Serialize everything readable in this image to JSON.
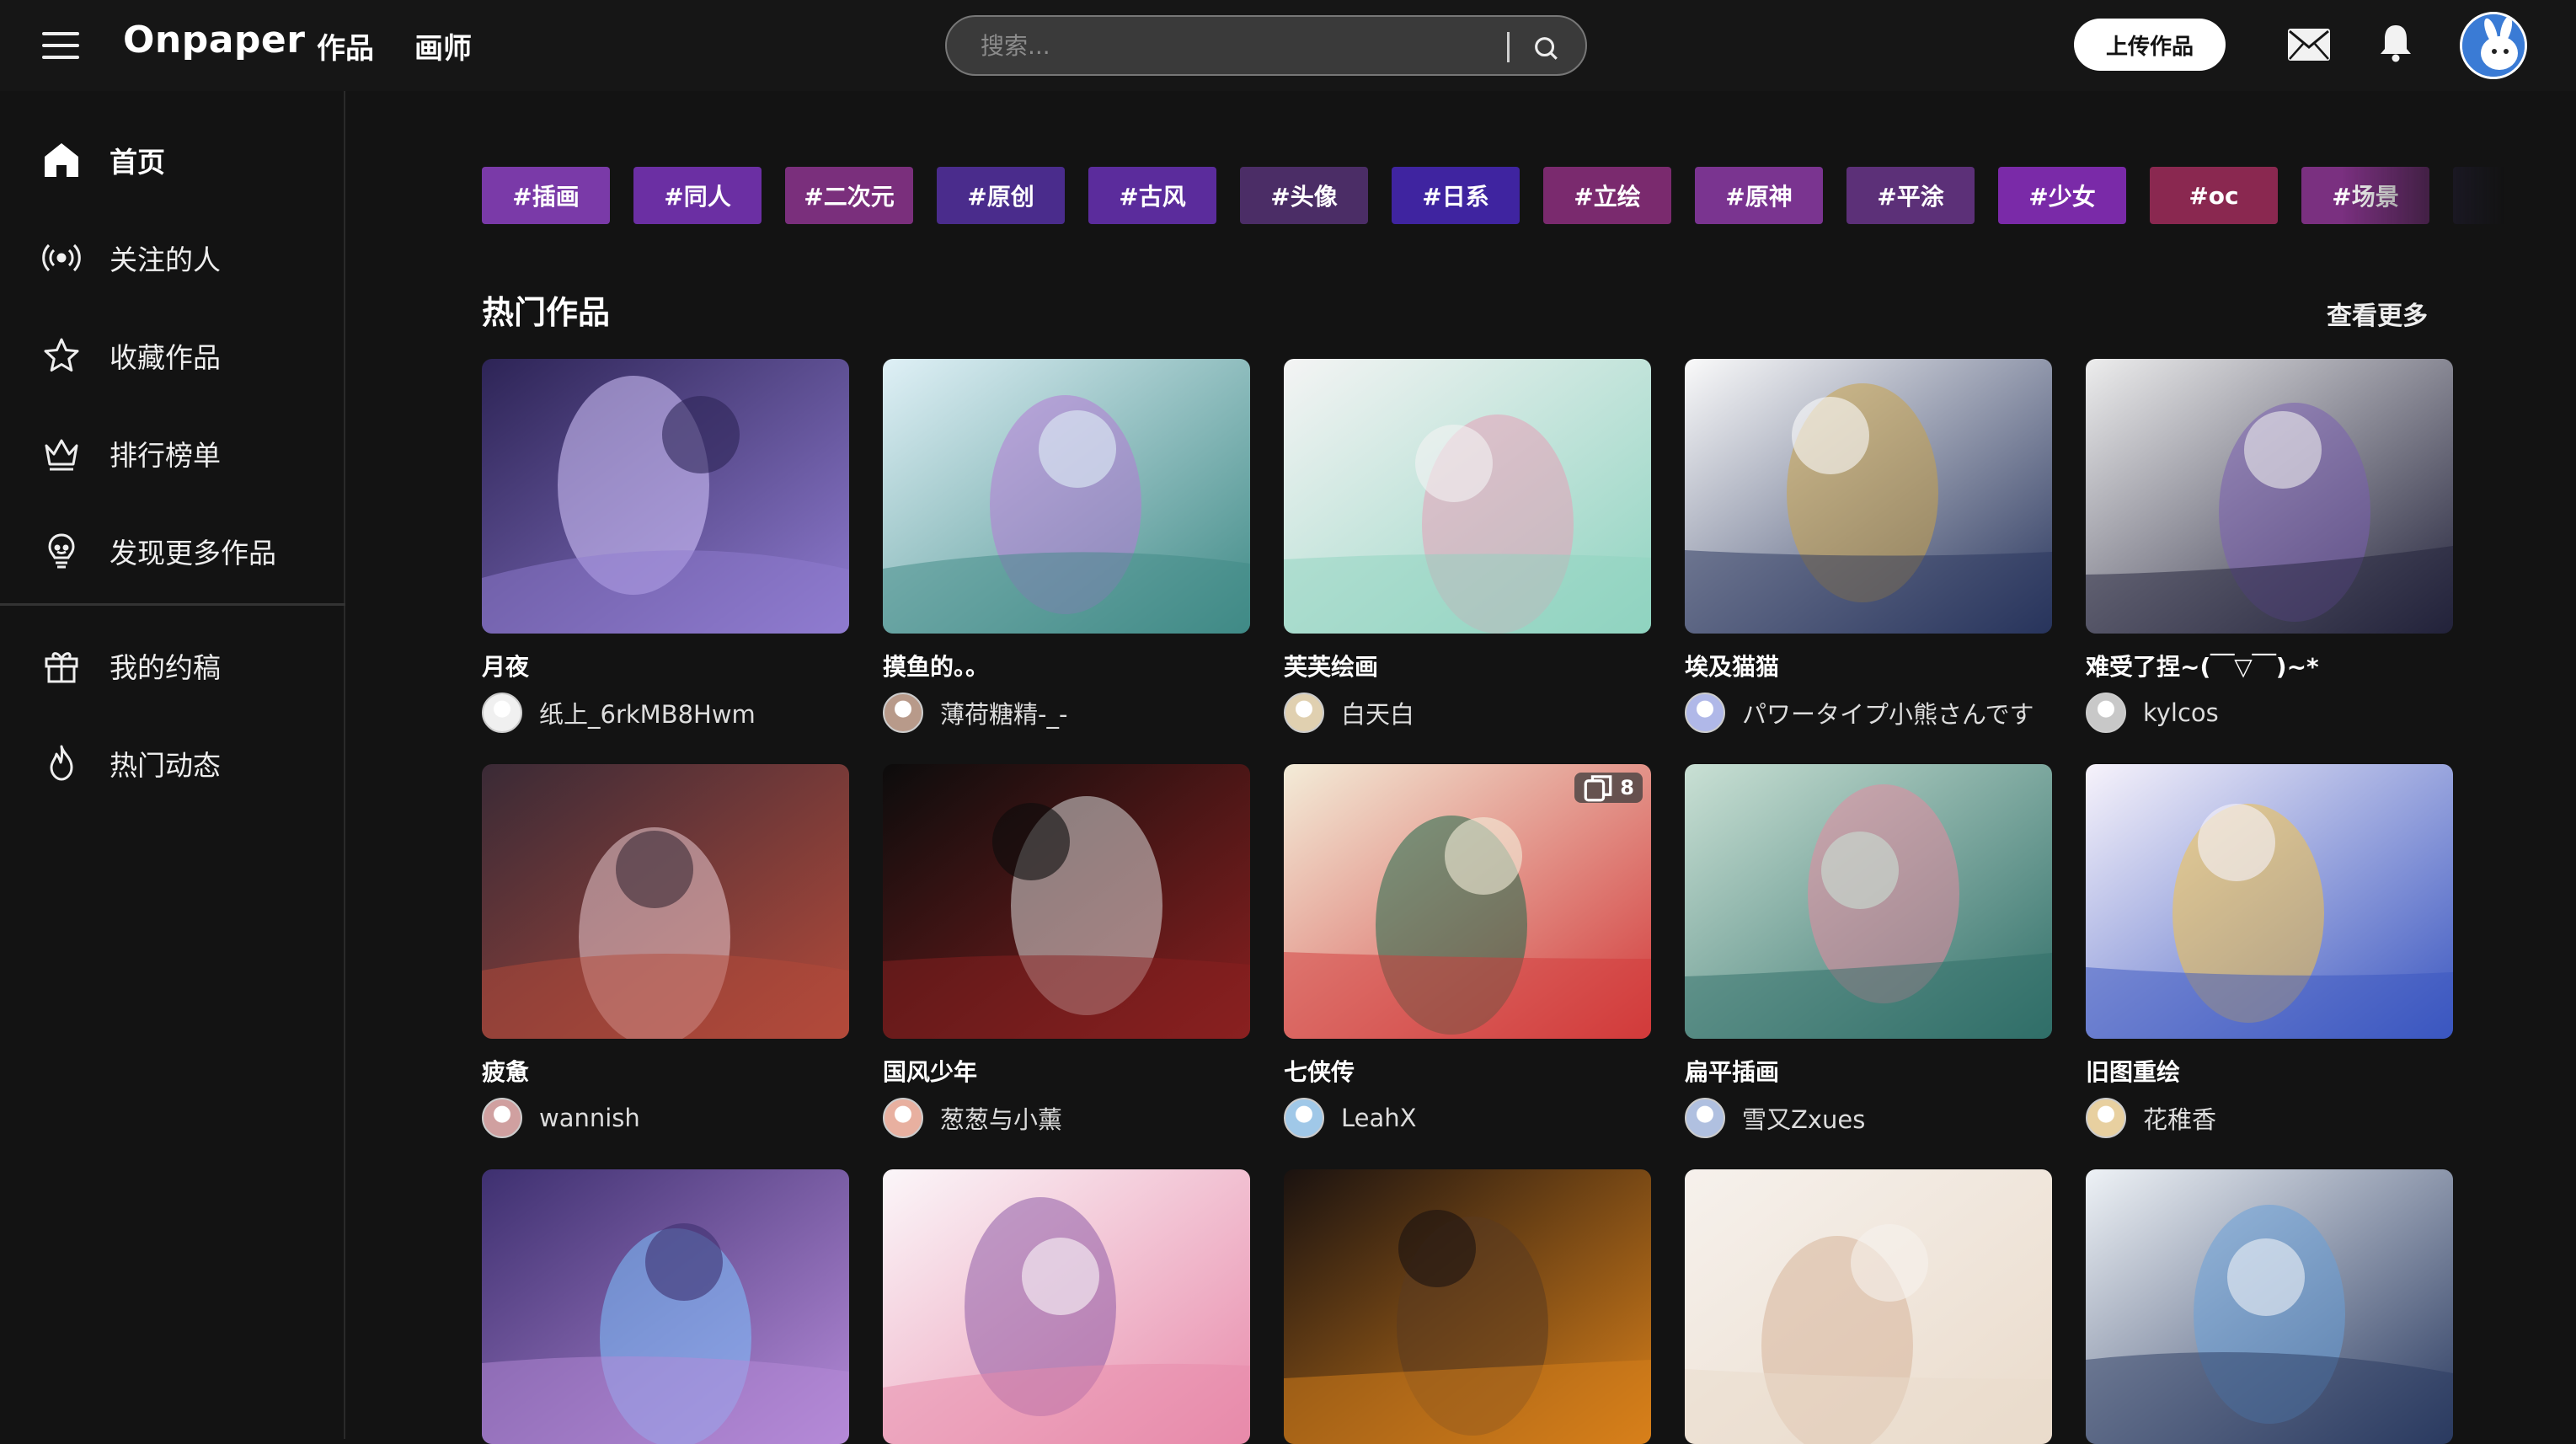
{
  "header": {
    "logo": "Onpaper",
    "nav": [
      "作品",
      "画师"
    ],
    "search_placeholder": "搜索...",
    "upload_label": "上传作品"
  },
  "sidebar": {
    "items": [
      {
        "label": "首页",
        "icon": "home-icon",
        "active": true
      },
      {
        "label": "关注的人",
        "icon": "broadcast-icon"
      },
      {
        "label": "收藏作品",
        "icon": "star-icon"
      },
      {
        "label": "排行榜单",
        "icon": "crown-icon"
      },
      {
        "label": "发现更多作品",
        "icon": "lightbulb-icon"
      },
      {
        "label": "我的约稿",
        "icon": "gift-icon"
      },
      {
        "label": "热门动态",
        "icon": "flame-icon"
      }
    ]
  },
  "tags": [
    {
      "label": "#插画",
      "color": "#7a3aa8"
    },
    {
      "label": "#同人",
      "color": "#6b2fa3"
    },
    {
      "label": "#二次元",
      "color": "#7a2f7c"
    },
    {
      "label": "#原创",
      "color": "#4a2c8c"
    },
    {
      "label": "#古风",
      "color": "#5b2c9c"
    },
    {
      "label": "#头像",
      "color": "#4b2d66"
    },
    {
      "label": "#日系",
      "color": "#3f24a0"
    },
    {
      "label": "#立绘",
      "color": "#7a2a6e"
    },
    {
      "label": "#原神",
      "color": "#7a3490"
    },
    {
      "label": "#平涂",
      "color": "#5c3078"
    },
    {
      "label": "#少女",
      "color": "#7a2aa8"
    },
    {
      "label": "#oc",
      "color": "#8a2850"
    },
    {
      "label": "#场景",
      "color": "#7a3080"
    },
    {
      "label": "",
      "color": "#2a2446"
    }
  ],
  "section": {
    "title": "热门作品",
    "more": "查看更多"
  },
  "works": [
    {
      "title": "月夜",
      "author": "纸上_6rkMB8Hwm"
    },
    {
      "title": "摸鱼的。。",
      "author": "薄荷糖精-_-"
    },
    {
      "title": "芙芙绘画",
      "author": "白天白"
    },
    {
      "title": "埃及猫猫",
      "author": "パワータイプ小熊さんです"
    },
    {
      "title": "难受了捏~(￣▽￣)~*",
      "author": "kylcos"
    },
    {
      "title": "疲惫",
      "author": "wannish"
    },
    {
      "title": "国风少年",
      "author": "葱葱与小薰"
    },
    {
      "title": "七侠传",
      "author": "LeahX",
      "count": "8"
    },
    {
      "title": "扁平插画",
      "author": "雪又Zxues"
    },
    {
      "title": "旧图重绘",
      "author": "花稚香"
    },
    {
      "title": "",
      "author": ""
    },
    {
      "title": "",
      "author": ""
    },
    {
      "title": "",
      "author": ""
    },
    {
      "title": "",
      "author": ""
    },
    {
      "title": "",
      "author": ""
    }
  ]
}
